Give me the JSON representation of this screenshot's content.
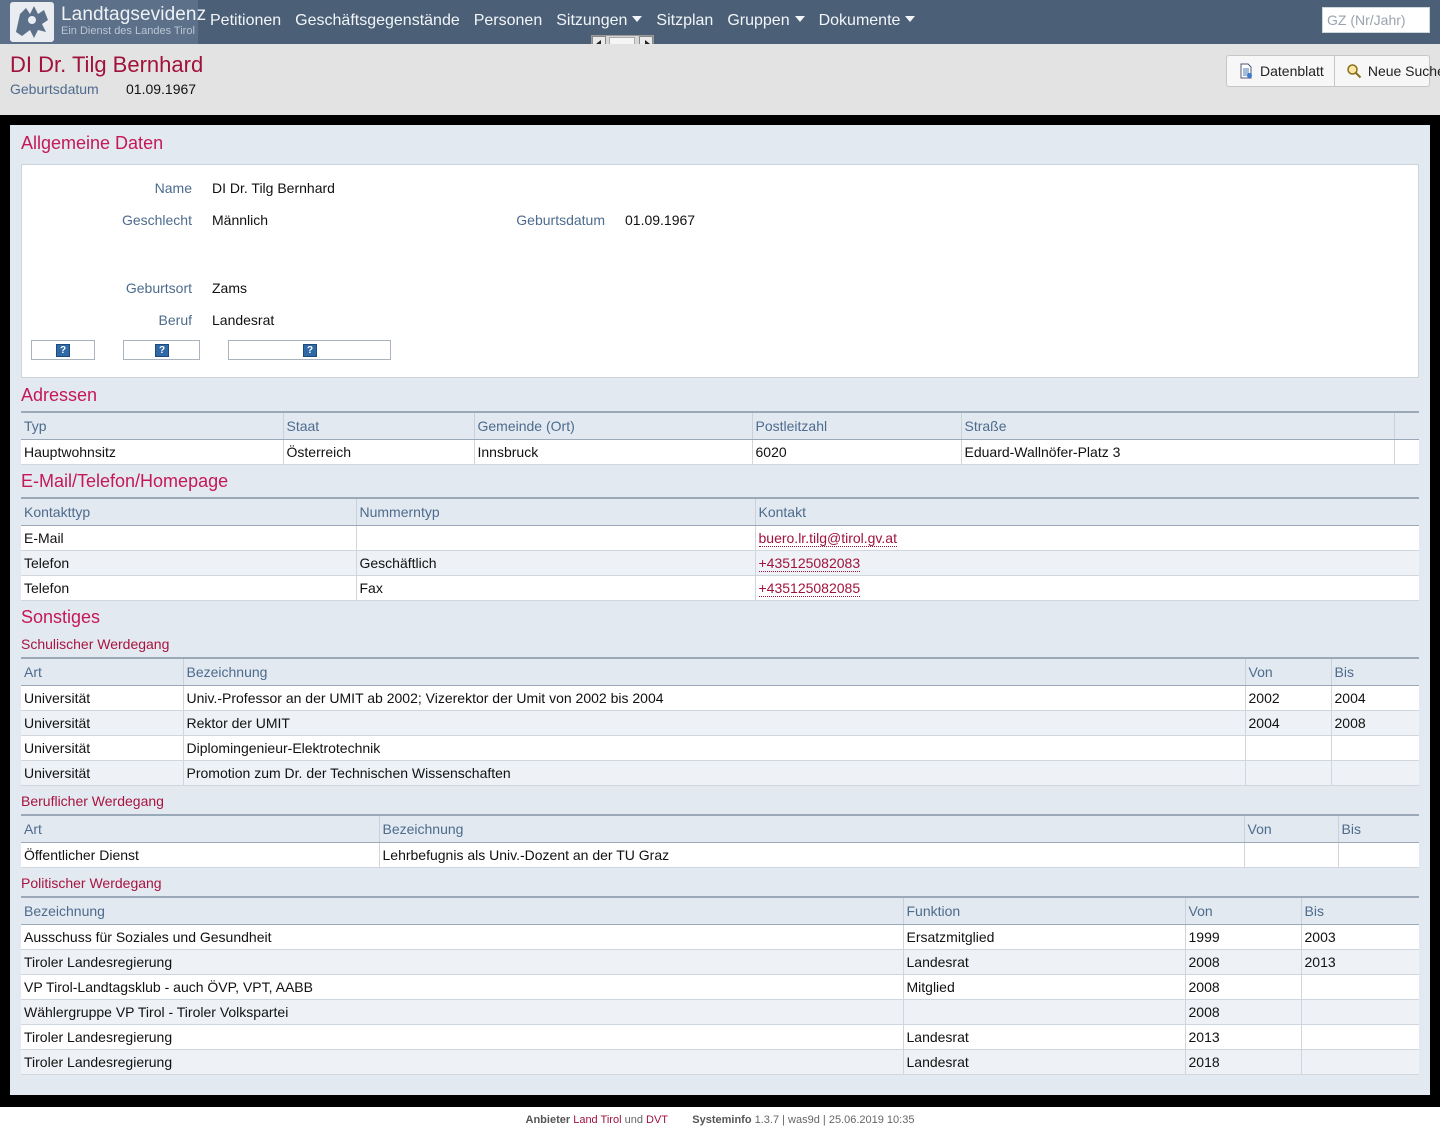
{
  "brand": {
    "title": "Landtagsevidenz",
    "subtitle": "Ein Dienst des Landes Tirol"
  },
  "nav": {
    "items": [
      {
        "label": "Petitionen",
        "dropdown": false
      },
      {
        "label": "Geschäftsgegenstände",
        "dropdown": false
      },
      {
        "label": "Personen",
        "dropdown": false
      },
      {
        "label": "Sitzungen",
        "dropdown": true
      },
      {
        "label": "Sitzplan",
        "dropdown": false
      },
      {
        "label": "Gruppen",
        "dropdown": true
      },
      {
        "label": "Dokumente",
        "dropdown": true
      }
    ],
    "search_placeholder": "GZ (Nr/Jahr)"
  },
  "header": {
    "title": "DI Dr. Tilg Bernhard",
    "birth_label": "Geburtsdatum",
    "birth_value": "01.09.1967",
    "buttons": {
      "datenblatt": "Datenblatt",
      "neue_suche": "Neue Suche"
    }
  },
  "allgemein": {
    "heading": "Allgemeine Daten",
    "name_label": "Name",
    "name_value": "DI Dr. Tilg Bernhard",
    "gender_label": "Geschlecht",
    "gender_value": "Männlich",
    "birthdate_label": "Geburtsdatum",
    "birthdate_value": "01.09.1967",
    "birthplace_label": "Geburtsort",
    "birthplace_value": "Zams",
    "job_label": "Beruf",
    "job_value": "Landesrat",
    "help_symbol": "?"
  },
  "adressen": {
    "heading": "Adressen",
    "columns": [
      "Typ",
      "Staat",
      "Gemeinde (Ort)",
      "Postleitzahl",
      "Straße"
    ],
    "rows": [
      [
        "Hauptwohnsitz",
        "Österreich",
        "Innsbruck",
        "6020",
        "Eduard-Wallnöfer-Platz 3"
      ]
    ]
  },
  "kontakt": {
    "heading": "E-Mail/Telefon/Homepage",
    "columns": [
      "Kontakttyp",
      "Nummerntyp",
      "Kontakt"
    ],
    "rows": [
      [
        "E-Mail",
        "",
        "buero.lr.tilg@tirol.gv.at"
      ],
      [
        "Telefon",
        "Geschäftlich",
        "+435125082083"
      ],
      [
        "Telefon",
        "Fax",
        "+435125082085"
      ]
    ]
  },
  "sonstiges": {
    "heading": "Sonstiges",
    "schule": {
      "heading": "Schulischer Werdegang",
      "columns": [
        "Art",
        "Bezeichnung",
        "Von",
        "Bis"
      ],
      "rows": [
        [
          "Universität",
          "Univ.-Professor an der UMIT ab 2002; Vizerektor der Umit von 2002 bis 2004",
          "2002",
          "2004"
        ],
        [
          "Universität",
          "Rektor der UMIT",
          "2004",
          "2008"
        ],
        [
          "Universität",
          "Diplomingenieur-Elektrotechnik",
          "",
          ""
        ],
        [
          "Universität",
          "Promotion zum Dr. der Technischen Wissenschaften",
          "",
          ""
        ]
      ]
    },
    "beruf": {
      "heading": "Beruflicher Werdegang",
      "columns": [
        "Art",
        "Bezeichnung",
        "Von",
        "Bis"
      ],
      "rows": [
        [
          "Öffentlicher Dienst",
          "Lehrbefugnis als Univ.-Dozent an der TU Graz",
          "",
          ""
        ]
      ]
    },
    "politik": {
      "heading": "Politischer Werdegang",
      "columns": [
        "Bezeichnung",
        "Funktion",
        "Von",
        "Bis"
      ],
      "rows": [
        [
          "Ausschuss für Soziales und Gesundheit",
          "Ersatzmitglied",
          "1999",
          "2003"
        ],
        [
          "Tiroler Landesregierung",
          "Landesrat",
          "2008",
          "2013"
        ],
        [
          "VP Tirol-Landtagsklub - auch ÖVP, VPT, AABB",
          "Mitglied",
          "2008",
          ""
        ],
        [
          "Wählergruppe VP Tirol - Tiroler Volkspartei",
          "",
          "2008",
          ""
        ],
        [
          "Tiroler Landesregierung",
          "Landesrat",
          "2013",
          ""
        ],
        [
          "Tiroler Landesregierung",
          "Landesrat",
          "2018",
          ""
        ]
      ]
    }
  },
  "footer": {
    "anbieter_label": "Anbieter",
    "anbieter_1": "Land Tirol",
    "und": "und",
    "anbieter_2": "DVT",
    "sysinfo_label": "Systeminfo",
    "sysinfo_value": "1.3.7 | was9d | 25.06.2019 10:35"
  },
  "colors": {
    "navbar": "#4b5f77",
    "accent": "#c4185a",
    "label": "#4d6b8d"
  }
}
